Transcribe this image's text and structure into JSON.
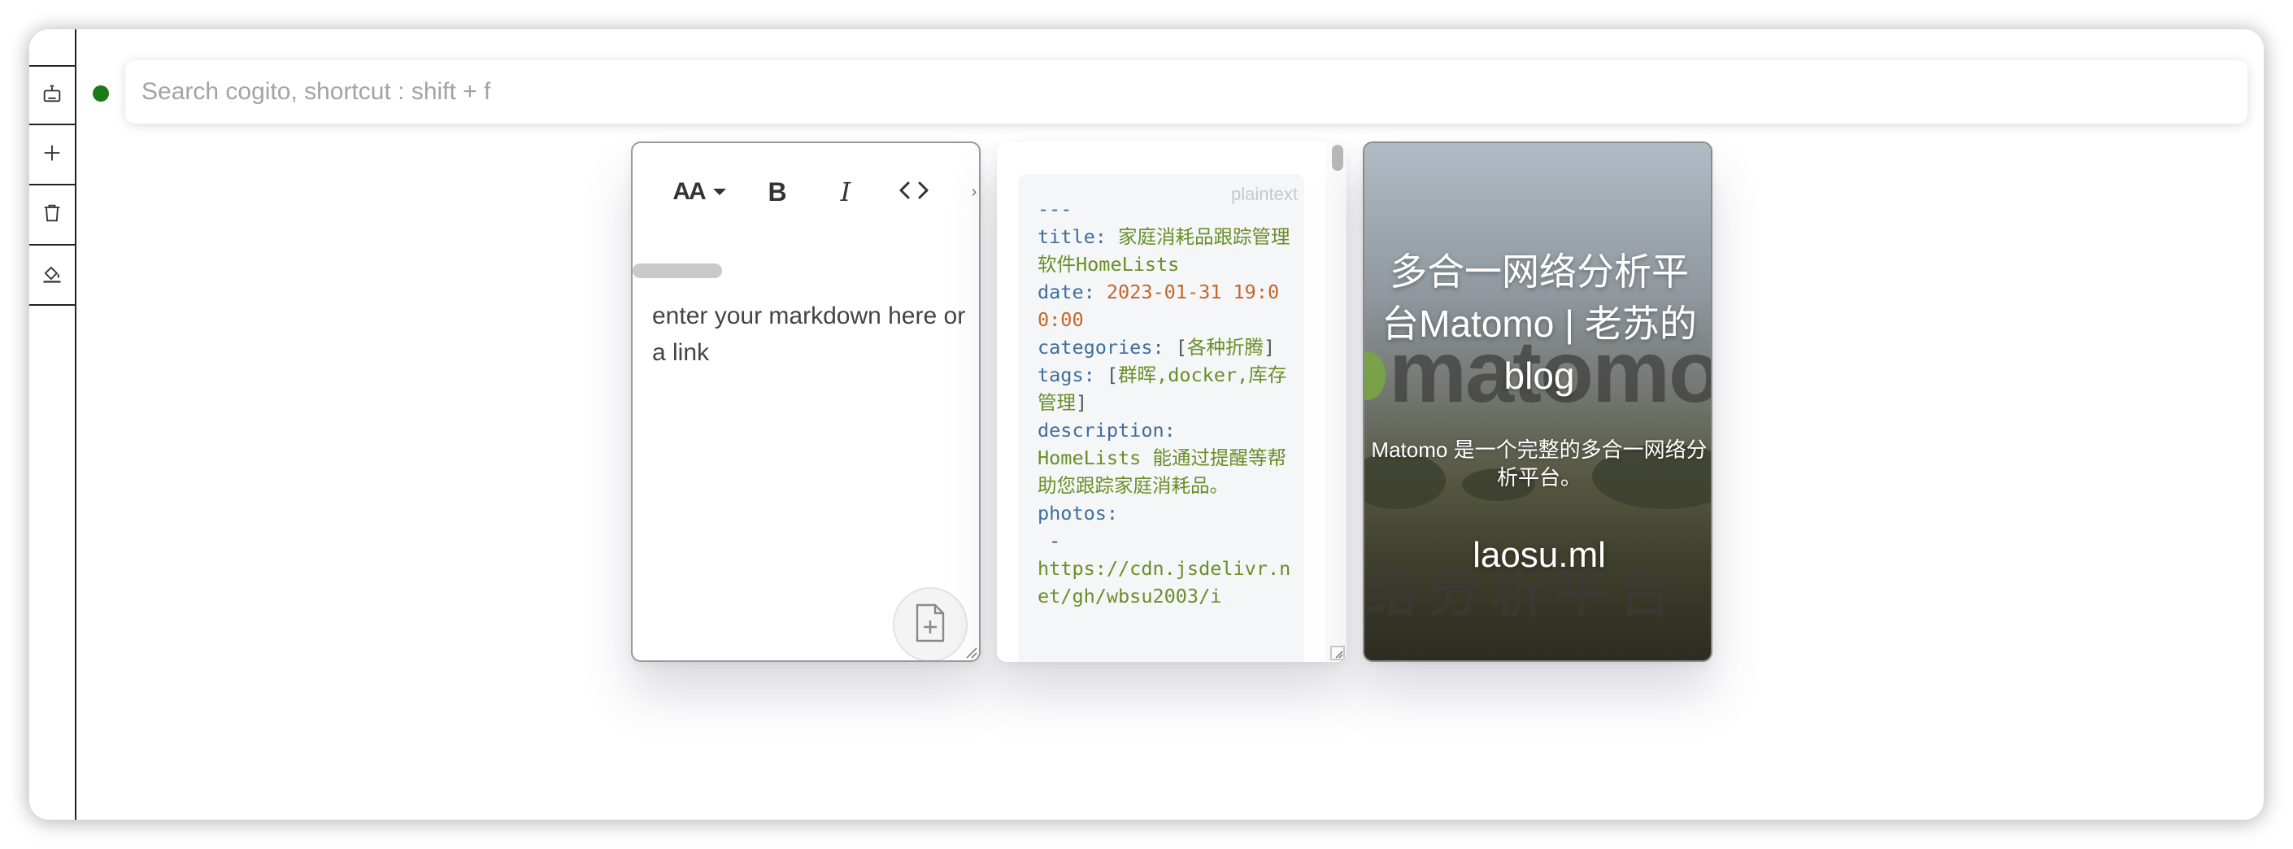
{
  "sidebar": {
    "items": [
      {
        "icon": "bot-icon",
        "label": ""
      },
      {
        "icon": "plus-icon",
        "label": ""
      },
      {
        "icon": "trash-icon",
        "label": ""
      },
      {
        "icon": "paint-bucket-icon",
        "label": ""
      }
    ]
  },
  "status": {
    "color": "#1a7a1a"
  },
  "search": {
    "placeholder": "Search cogito, shortcut : shift + f",
    "value": ""
  },
  "editor": {
    "toolbar": {
      "font_label": "AA",
      "bold_label": "B",
      "italic_label": "I"
    },
    "placeholder_text": "enter your markdown here or a link"
  },
  "code_card": {
    "language": "plaintext",
    "lines": {
      "l1": "---",
      "l2_key": "title:",
      "l2_val": "家庭消耗品跟踪管理软件HomeLists",
      "l3_key": "date:",
      "l3_val": "2023-01-31 19:00:00",
      "l4_key": "categories:",
      "l4_open": "[",
      "l4_val": "各种折腾",
      "l4_close": "]",
      "l5_key": "tags:",
      "l5_open": "[",
      "l5_val": "群晖,docker,库存管理",
      "l5_close": "]",
      "l6_key": "description:",
      "l6_val": "HomeLists 能通过提醒等帮助您跟踪家庭消耗品。",
      "l7_key": "photos:",
      "l8_dash": " -",
      "l8_val": "https://cdn.jsdelivr.net/gh/wbsu2003/i"
    }
  },
  "preview": {
    "title": "多合一网络分析平台Matomo | 老苏的blog",
    "description": "Matomo 是一个完整的多合一网络分析平台。",
    "domain": "laosu.ml",
    "background_logo": "matomo",
    "background_banner": "络分析平台"
  }
}
